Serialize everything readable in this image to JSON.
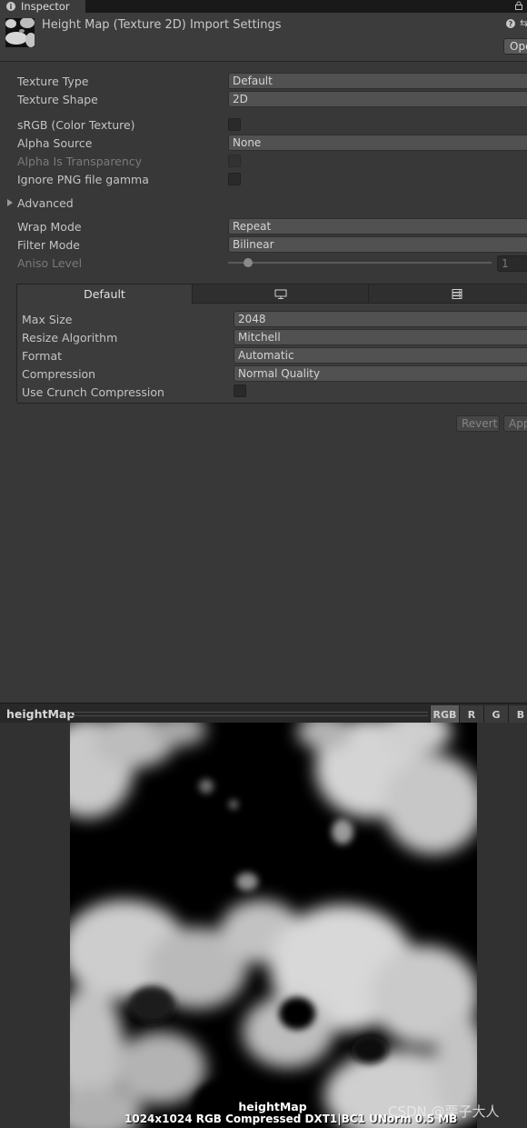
{
  "tab": {
    "label": "Inspector",
    "icon": "info-icon"
  },
  "header": {
    "title": "Height Map (Texture 2D) Import Settings",
    "open_label": "Open"
  },
  "fields": {
    "texture_type": {
      "label": "Texture Type",
      "value": "Default"
    },
    "texture_shape": {
      "label": "Texture Shape",
      "value": "2D"
    },
    "srgb": {
      "label": "sRGB (Color Texture)",
      "checked": false
    },
    "alpha_source": {
      "label": "Alpha Source",
      "value": "None"
    },
    "alpha_is_transparency": {
      "label": "Alpha Is Transparency",
      "checked": false
    },
    "ignore_png_gamma": {
      "label": "Ignore PNG file gamma",
      "checked": false
    },
    "advanced": {
      "label": "Advanced"
    },
    "wrap_mode": {
      "label": "Wrap Mode",
      "value": "Repeat"
    },
    "filter_mode": {
      "label": "Filter Mode",
      "value": "Bilinear"
    },
    "aniso_level": {
      "label": "Aniso Level",
      "value": "1"
    }
  },
  "platform": {
    "tabs": [
      {
        "label": "Default",
        "icon": null
      },
      {
        "label": "",
        "icon": "monitor-icon"
      },
      {
        "label": "",
        "icon": "server-icon"
      }
    ],
    "max_size": {
      "label": "Max Size",
      "value": "2048"
    },
    "resize_algorithm": {
      "label": "Resize Algorithm",
      "value": "Mitchell"
    },
    "format": {
      "label": "Format",
      "value": "Automatic"
    },
    "compression": {
      "label": "Compression",
      "value": "Normal Quality"
    },
    "crunch": {
      "label": "Use Crunch Compression",
      "checked": false
    }
  },
  "actions": {
    "revert": "Revert",
    "apply": "Apply"
  },
  "preview": {
    "title": "heightMap",
    "channels": [
      "RGB",
      "R",
      "G",
      "B"
    ],
    "active_channel": "RGB",
    "image_name": "heightMap",
    "info": "1024x1024  RGB Compressed DXT1|BC1 UNorm  0.5 MB"
  },
  "watermark": "CSDN @栗子大人",
  "colors": {
    "panel": "#383838",
    "header": "#3c3c3c",
    "field": "#515151",
    "text": "#c4c4c4"
  }
}
